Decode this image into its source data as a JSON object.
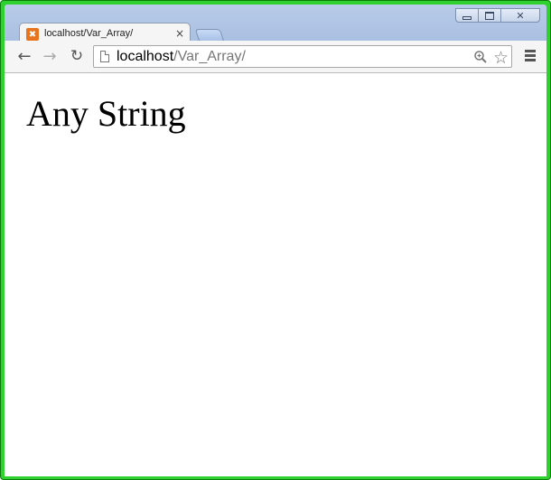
{
  "window": {
    "controls": {
      "minimize_icon": "minimize-icon",
      "maximize_icon": "maximize-icon",
      "close_icon": "close-icon",
      "close_label": "✕"
    },
    "frame_color": "#2fd12f"
  },
  "tabs": [
    {
      "title": "localhost/Var_Array/",
      "favicon": "xampp-icon",
      "favicon_glyph": "✖",
      "close_label": "×",
      "active": true
    }
  ],
  "toolbar": {
    "back_label": "←",
    "forward_label": "→",
    "reload_label": "↻",
    "menu_icon": "hamburger-menu-icon"
  },
  "omnibox": {
    "host": "localhost",
    "path": "/Var_Array/",
    "star_label": "☆"
  },
  "page": {
    "heading": "Any String"
  }
}
